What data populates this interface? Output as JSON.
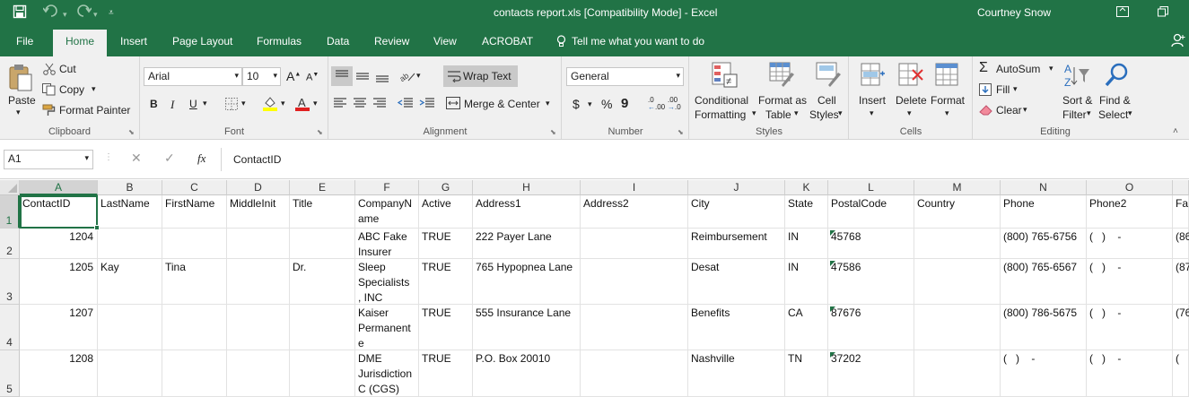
{
  "title_bar": {
    "document_title": "contacts report.xls  [Compatibility Mode]  -  Excel",
    "user_name": "Courtney Snow",
    "qat_save_icon": "save-icon",
    "qat_undo_icon": "undo-icon",
    "qat_redo_icon": "redo-icon"
  },
  "tabs": [
    {
      "label": "File"
    },
    {
      "label": "Home"
    },
    {
      "label": "Insert"
    },
    {
      "label": "Page Layout"
    },
    {
      "label": "Formulas"
    },
    {
      "label": "Data"
    },
    {
      "label": "Review"
    },
    {
      "label": "View"
    },
    {
      "label": "ACROBAT"
    }
  ],
  "tell_me": "Tell me what you want to do",
  "clipboard": {
    "paste": "Paste",
    "cut": "Cut",
    "copy": "Copy",
    "format_painter": "Format Painter",
    "label": "Clipboard"
  },
  "font": {
    "family": "Arial",
    "size": "10",
    "bold": "B",
    "italic": "I",
    "underline": "U",
    "label": "Font",
    "grow": "A",
    "shrink": "A",
    "font_color": "A"
  },
  "alignment": {
    "wrap_text": "Wrap Text",
    "merge_center": "Merge & Center",
    "label": "Alignment"
  },
  "number": {
    "format": "General",
    "currency": "$",
    "percent": "%",
    "comma": "9",
    "inc_dec": ".0",
    "dec_dec": ".00",
    "label": "Number"
  },
  "styles": {
    "conditional": "Conditional",
    "conditional2": "Formatting",
    "format_as": "Format as",
    "format_as2": "Table",
    "cell": "Cell",
    "cell2": "Styles",
    "label": "Styles"
  },
  "cells": {
    "insert": "Insert",
    "delete": "Delete",
    "format": "Format",
    "label": "Cells"
  },
  "editing": {
    "autosum": "AutoSum",
    "fill": "Fill",
    "clear": "Clear",
    "sort1": "Sort &",
    "sort2": "Filter",
    "find1": "Find &",
    "find2": "Select",
    "label": "Editing"
  },
  "formula_bar": {
    "name_box": "A1",
    "fx": "fx",
    "value": "ContactID"
  },
  "columns": [
    "A",
    "B",
    "C",
    "D",
    "E",
    "F",
    "G",
    "H",
    "I",
    "J",
    "K",
    "L",
    "M",
    "N",
    "O"
  ],
  "rows": [
    "1",
    "2",
    "3",
    "4",
    "5"
  ],
  "header_row": [
    "ContactID",
    "LastName",
    "FirstName",
    "MiddleInit",
    "Title",
    "CompanyN\name",
    "Active",
    "Address1",
    "Address2",
    "City",
    "State",
    "PostalCode",
    "Country",
    "Phone",
    "Phone2",
    "Fa"
  ],
  "data_rows": [
    {
      "contact_id": "1204",
      "last": "",
      "first": "",
      "middle": "",
      "title": "",
      "company": "ABC Fake\nInsurer",
      "active": "TRUE",
      "address1": "222 Payer Lane",
      "address2": "",
      "city": "Reimbursement",
      "state": "IN",
      "postal": "45768",
      "country": "",
      "phone": "(800) 765-6756",
      "phone2": "(   )    -",
      "fax": "(86"
    },
    {
      "contact_id": "1205",
      "last": "Kay",
      "first": "Tina",
      "middle": "",
      "title": "Dr.",
      "company": "Sleep\nSpecialists\n, INC",
      "active": "TRUE",
      "address1": "765 Hypopnea Lane",
      "address2": "",
      "city": "Desat",
      "state": "IN",
      "postal": "47586",
      "country": "",
      "phone": "(800) 765-6567",
      "phone2": "(   )    -",
      "fax": "(87"
    },
    {
      "contact_id": "1207",
      "last": "",
      "first": "",
      "middle": "",
      "title": "",
      "company": "Kaiser\nPermanent\ne",
      "active": "TRUE",
      "address1": "555 Insurance Lane",
      "address2": "",
      "city": "Benefits",
      "state": "CA",
      "postal": "87676",
      "country": "",
      "phone": "(800) 786-5675",
      "phone2": "(   )    -",
      "fax": "(76"
    },
    {
      "contact_id": "1208",
      "last": "",
      "first": "",
      "middle": "",
      "title": "",
      "company": "DME\nJurisdiction\nC (CGS)",
      "active": "TRUE",
      "address1": "P.O. Box 20010",
      "address2": "",
      "city": "Nashville",
      "state": "TN",
      "postal": "37202",
      "country": "",
      "phone": "(   )    -",
      "phone2": "(   )    -",
      "fax": "("
    }
  ],
  "colors": {
    "excel_green": "#217346",
    "ribbon_bg": "#f0f0f0"
  }
}
